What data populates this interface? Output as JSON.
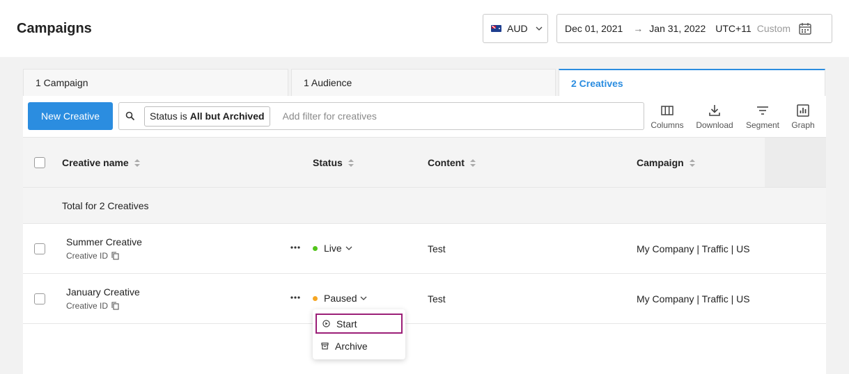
{
  "header": {
    "title": "Campaigns",
    "currency": "AUD",
    "date_start": "Dec 01, 2021",
    "date_arrow": "→",
    "date_end": "Jan 31, 2022",
    "timezone": "UTC+11",
    "range_type": "Custom"
  },
  "tabs": [
    {
      "label": "1 Campaign"
    },
    {
      "label": "1 Audience"
    },
    {
      "label": "2 Creatives"
    }
  ],
  "toolbar": {
    "new_label": "New Creative",
    "filter_prefix": "Status is",
    "filter_value": "All but Archived",
    "search_placeholder": "Add filter for creatives",
    "columns_label": "Columns",
    "download_label": "Download",
    "segment_label": "Segment",
    "graph_label": "Graph"
  },
  "table": {
    "headers": {
      "name": "Creative name",
      "status": "Status",
      "content": "Content",
      "campaign": "Campaign"
    },
    "total_label": "Total for 2 Creatives",
    "rows": [
      {
        "name": "Summer Creative",
        "id_label": "Creative ID",
        "status": "Live",
        "status_color": "#52c41a",
        "content": "Test",
        "campaign": "My Company | Traffic | US"
      },
      {
        "name": "January Creative",
        "id_label": "Creative ID",
        "status": "Paused",
        "status_color": "#f5a623",
        "content": "Test",
        "campaign": "My Company | Traffic | US"
      }
    ]
  },
  "status_menu": {
    "items": [
      {
        "label": "Start",
        "icon": "play-circle-icon"
      },
      {
        "label": "Archive",
        "icon": "archive-icon"
      }
    ]
  },
  "colors": {
    "accent": "#2b8de0",
    "highlight": "#9b1e77"
  }
}
